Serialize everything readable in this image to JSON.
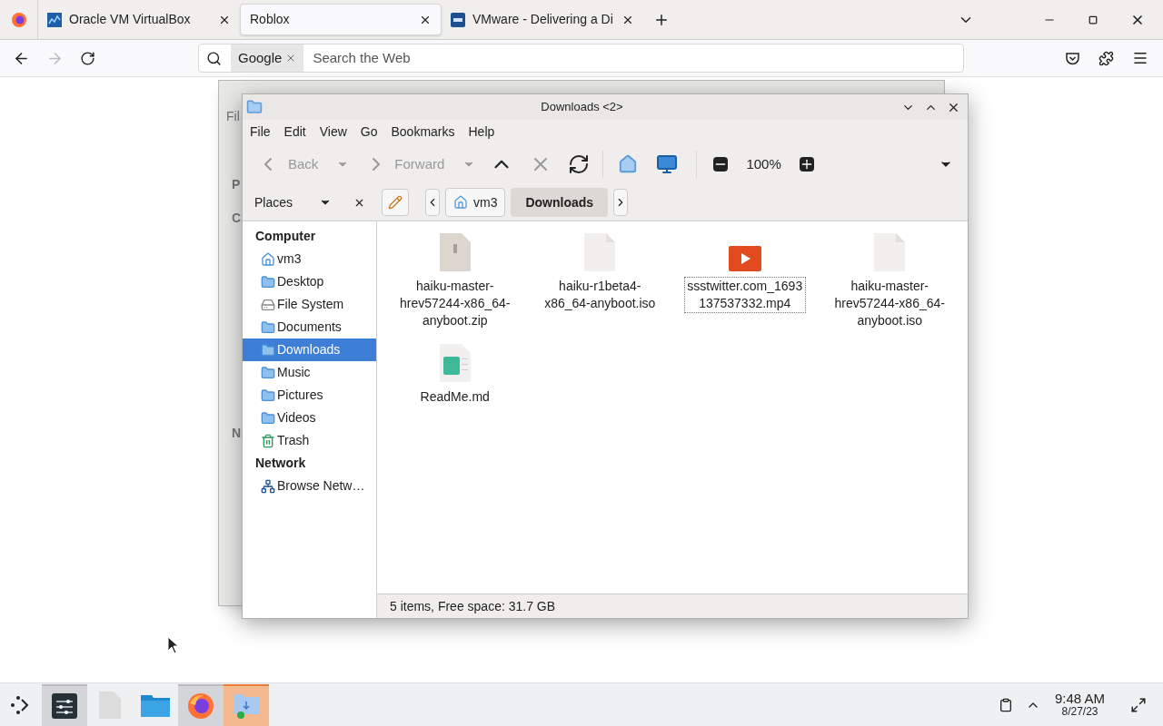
{
  "browser": {
    "tabs": [
      {
        "label": "Oracle VM VirtualBox",
        "kind": "chart",
        "selected": false
      },
      {
        "label": "Roblox",
        "kind": "none",
        "selected": true
      },
      {
        "label": "VMware - Delivering a Di",
        "kind": "vm",
        "selected": false
      }
    ],
    "search": {
      "engine": "Google",
      "placeholder": "Search the Web"
    }
  },
  "back_window": {
    "menu": "Fil",
    "labels": [
      "P",
      "C",
      "N"
    ]
  },
  "window": {
    "title": "Downloads <2>",
    "menu": [
      "File",
      "Edit",
      "View",
      "Go",
      "Bookmarks",
      "Help"
    ],
    "toolbar": {
      "back": {
        "label": "Back",
        "disabled": true
      },
      "forward": {
        "label": "Forward",
        "disabled": true
      },
      "zoom": "100%"
    },
    "sidebar": {
      "title": "Places",
      "sections": [
        {
          "title": "Computer",
          "items": [
            {
              "label": "vm3",
              "kind": "home",
              "selected": false
            },
            {
              "label": "Desktop",
              "kind": "folder",
              "selected": false
            },
            {
              "label": "File System",
              "kind": "drive",
              "selected": false
            },
            {
              "label": "Documents",
              "kind": "folder",
              "selected": false
            },
            {
              "label": "Downloads",
              "kind": "folder",
              "selected": true
            },
            {
              "label": "Music",
              "kind": "folder",
              "selected": false
            },
            {
              "label": "Pictures",
              "kind": "folder",
              "selected": false
            },
            {
              "label": "Videos",
              "kind": "folder",
              "selected": false
            },
            {
              "label": "Trash",
              "kind": "trash",
              "selected": false
            }
          ]
        },
        {
          "title": "Network",
          "items": [
            {
              "label": "Browse Netw…",
              "kind": "network",
              "selected": false
            }
          ]
        }
      ]
    },
    "path": [
      {
        "label": "vm3",
        "selected": false
      },
      {
        "label": "Downloads",
        "selected": true
      }
    ],
    "files": [
      {
        "name": "haiku-master-hrev57244-x86_64-anyboot.zip",
        "kind": "archive",
        "selected": false
      },
      {
        "name": "haiku-r1beta4-x86_64-anyboot.iso",
        "kind": "blank",
        "selected": false
      },
      {
        "name": "ssstwitter.com_1693137537332.mp4",
        "kind": "video",
        "selected": true
      },
      {
        "name": "haiku-master-hrev57244-x86_64-anyboot.iso",
        "kind": "blank",
        "selected": false
      },
      {
        "name": "ReadMe.md",
        "kind": "text",
        "selected": false
      }
    ],
    "status": "5 items, Free space: 31.7 GB"
  },
  "taskbar": {
    "apps": [
      {
        "kind": "settings",
        "active": true
      },
      {
        "kind": "file",
        "active": false
      },
      {
        "kind": "folder",
        "active": false
      },
      {
        "kind": "browser",
        "active": true
      },
      {
        "kind": "files",
        "active": true
      }
    ],
    "time": "9:48 AM",
    "date": "8/27/23"
  }
}
